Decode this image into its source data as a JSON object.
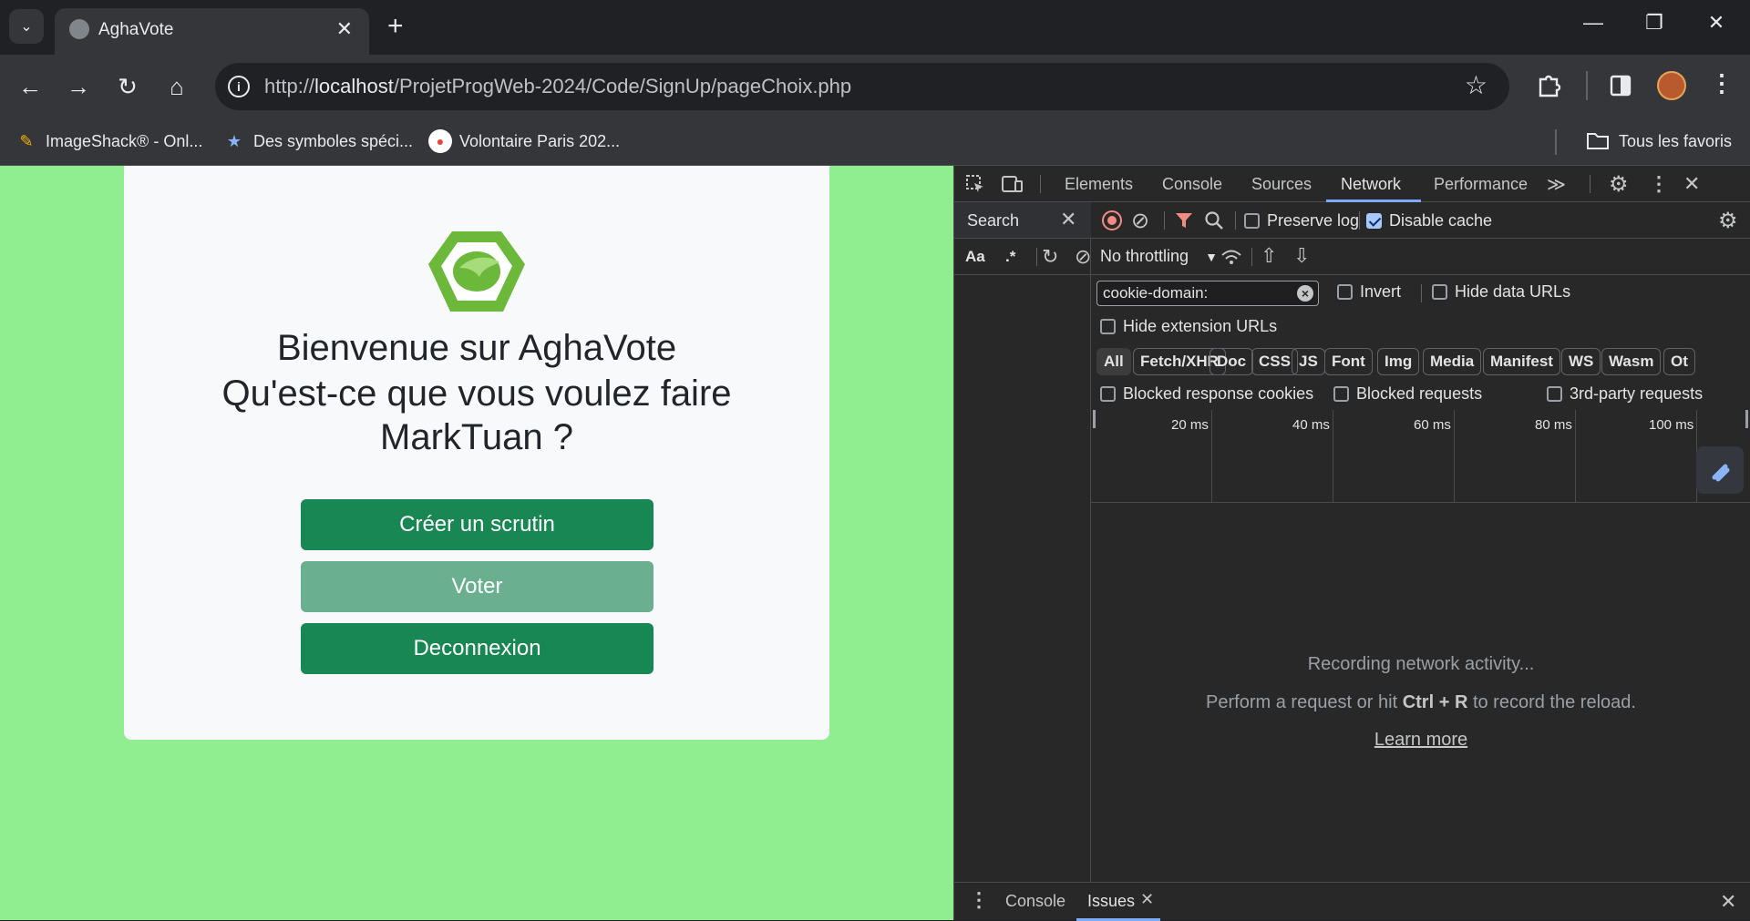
{
  "browser": {
    "tab": {
      "title": "AghaVote",
      "close": "✕"
    },
    "new_tab": "+",
    "window": {
      "minimize": "—",
      "restore": "❐",
      "close": "✕"
    },
    "nav": {
      "back": "←",
      "forward": "→",
      "reload": "↻",
      "home": "⌂"
    },
    "url": {
      "prefix": "http://",
      "host": "localhost",
      "path": "/ProjetProgWeb-2024/Code/SignUp/pageChoix.php"
    },
    "bookmarks": [
      {
        "label": "ImageShack® - Onl...",
        "icon": "imageshack-icon",
        "color": "#f4b400"
      },
      {
        "label": "Des symboles spéci...",
        "icon": "star-icon",
        "color": "#8ab4f8"
      },
      {
        "label": "Volontaire Paris 202...",
        "icon": "paris-2024-icon",
        "color": "#e8453c"
      }
    ],
    "all_bookmarks": "Tous les favoris"
  },
  "page": {
    "background": "#90ee90",
    "heading": "Bienvenue sur AghaVote",
    "question_line1": "Qu'est-ce que vous voulez faire",
    "question_line2": "MarkTuan ?",
    "buttons": {
      "create": "Créer un scrutin",
      "vote": "Voter",
      "logout": "Deconnexion"
    }
  },
  "devtools": {
    "tabs": [
      "Elements",
      "Console",
      "Sources",
      "Network",
      "Performance"
    ],
    "active_tab": "Network",
    "more_tabs": "≫",
    "search": {
      "label": "Search",
      "case_toggle": "Aa",
      "regex_toggle": ".*"
    },
    "network": {
      "preserve_log": "Preserve log",
      "disable_cache": "Disable cache",
      "throttling": "No throttling",
      "filter_value": "cookie-domain:",
      "invert": "Invert",
      "hide_data_urls": "Hide data URLs",
      "hide_extension_urls": "Hide extension URLs",
      "type_filters": [
        "All",
        "Fetch/XHR",
        "Doc",
        "CSS",
        "JS",
        "Font",
        "Img",
        "Media",
        "Manifest",
        "WS",
        "Wasm",
        "Ot"
      ],
      "blocked_response_cookies": "Blocked response cookies",
      "blocked_requests": "Blocked requests",
      "third_party_requests": "3rd-party requests",
      "timeline_ticks": [
        "20 ms",
        "40 ms",
        "60 ms",
        "80 ms",
        "100 ms"
      ],
      "empty_title": "Recording network activity...",
      "empty_hint_pre": "Perform a request or hit ",
      "empty_hint_keys": "Ctrl + R",
      "empty_hint_post": " to record the reload.",
      "learn_more": "Learn more"
    },
    "drawer": {
      "console": "Console",
      "issues": "Issues"
    }
  }
}
